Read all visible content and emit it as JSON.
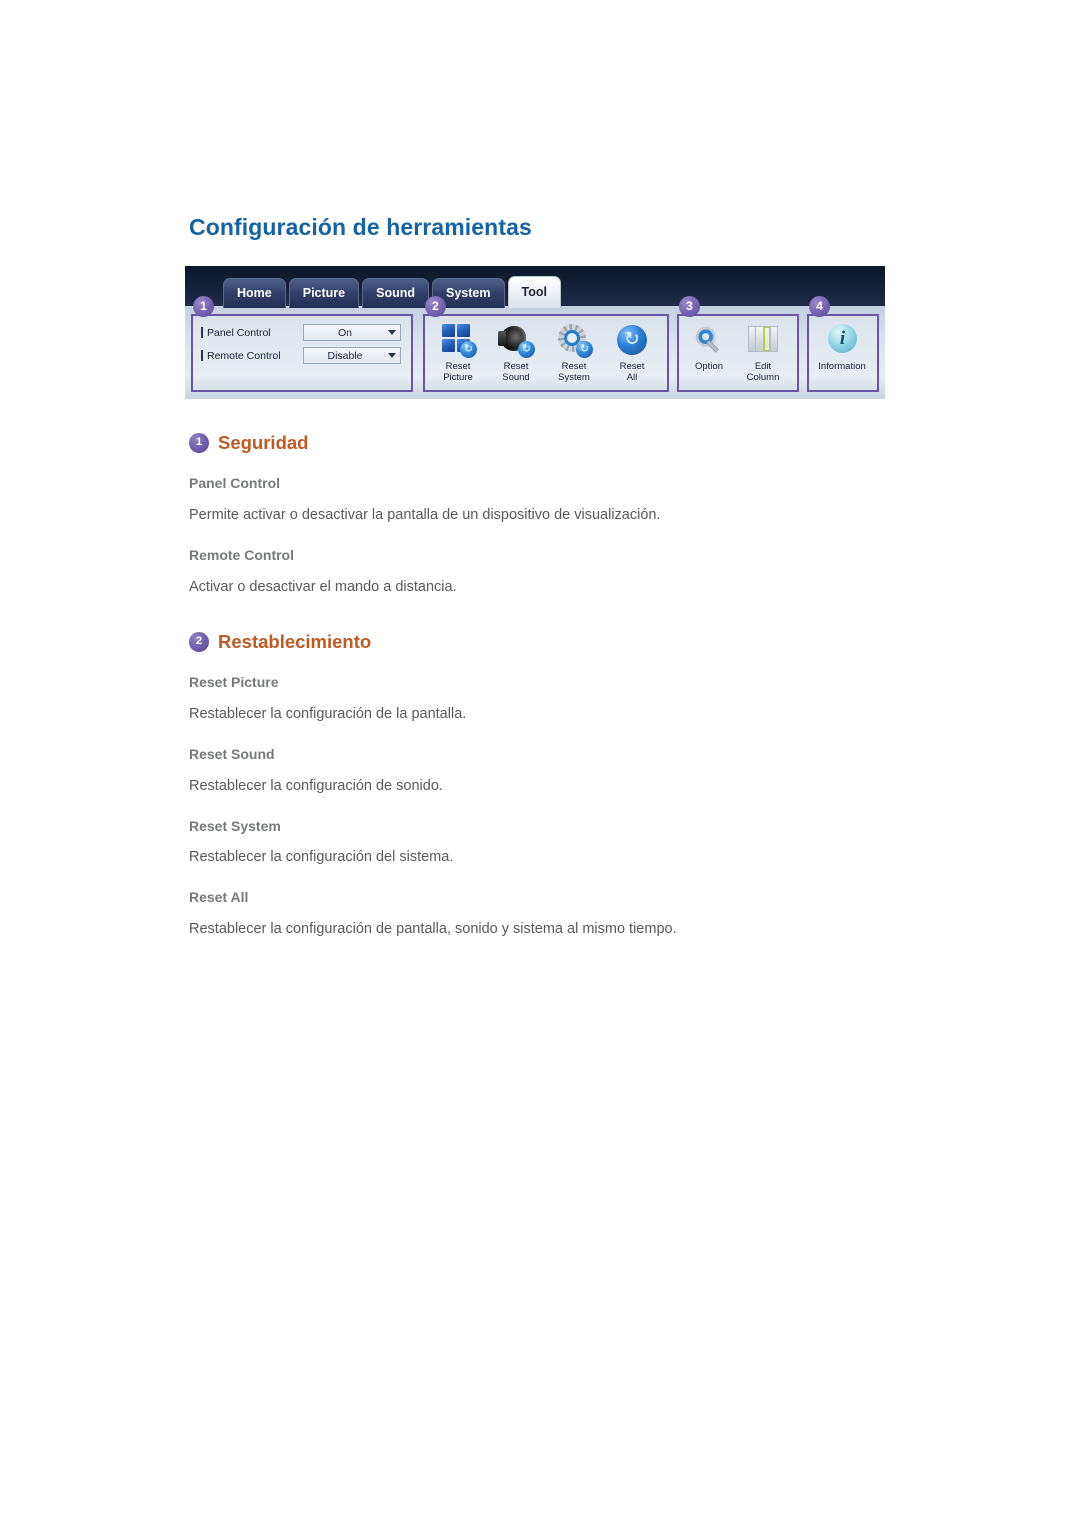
{
  "page": {
    "title": "Configuración de herramientas"
  },
  "figure": {
    "alt_name": "tool-settings-toolbar-screenshot",
    "tabs": [
      {
        "label": "Home",
        "active": false
      },
      {
        "label": "Picture",
        "active": false
      },
      {
        "label": "Sound",
        "active": false
      },
      {
        "label": "System",
        "active": false
      },
      {
        "label": "Tool",
        "active": true
      }
    ],
    "callouts": [
      "1",
      "2",
      "3",
      "4"
    ],
    "group1": {
      "rows": [
        {
          "label": "Panel Control",
          "value": "On"
        },
        {
          "label": "Remote Control",
          "value": "Disable"
        }
      ]
    },
    "group2": {
      "buttons": [
        {
          "icon": "reset-picture-icon",
          "label": "Reset\nPicture"
        },
        {
          "icon": "reset-sound-icon",
          "label": "Reset\nSound"
        },
        {
          "icon": "reset-system-icon",
          "label": "Reset\nSystem"
        },
        {
          "icon": "reset-all-icon",
          "label": "Reset\nAll"
        }
      ]
    },
    "group3": {
      "buttons": [
        {
          "icon": "option-icon",
          "label": "Option"
        },
        {
          "icon": "edit-column-icon",
          "label": "Edit\nColumn"
        }
      ]
    },
    "group4": {
      "buttons": [
        {
          "icon": "information-icon",
          "label": "Information"
        }
      ]
    }
  },
  "sections": [
    {
      "badge": "1",
      "title": "Seguridad",
      "items": [
        {
          "title": "Panel Control",
          "desc": "Permite activar o desactivar la pantalla de un dispositivo de visualización."
        },
        {
          "title": "Remote Control",
          "desc": "Activar o desactivar el mando a distancia."
        }
      ]
    },
    {
      "badge": "2",
      "title": "Restablecimiento",
      "items": [
        {
          "title": "Reset Picture",
          "desc": "Restablecer la configuración de la pantalla."
        },
        {
          "title": "Reset Sound",
          "desc": "Restablecer la configuración de sonido."
        },
        {
          "title": "Reset System",
          "desc": "Restablecer la configuración del sistema."
        },
        {
          "title": "Reset All",
          "desc": "Restablecer la configuración de pantalla, sonido y sistema al mismo tiempo."
        }
      ]
    }
  ],
  "colors": {
    "page_title": "#1464a5",
    "section_title": "#c05a21",
    "badge": "#6f5fae",
    "item_title": "#77797c",
    "body_text": "#58595b",
    "group_border": "#6a55a5"
  }
}
